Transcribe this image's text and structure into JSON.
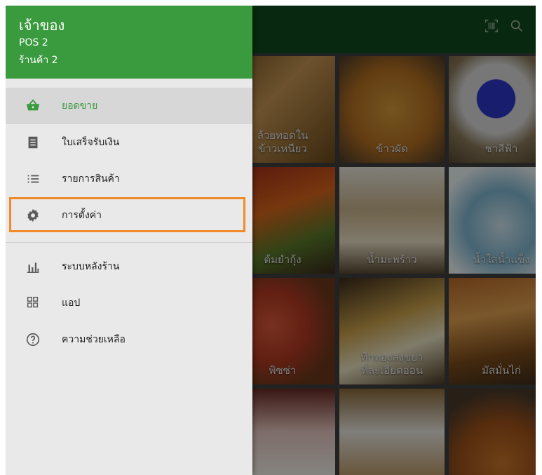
{
  "drawer": {
    "owner": "เจ้าของ",
    "pos": "POS 2",
    "store": "ร้านค้า 2",
    "items": [
      {
        "label": "ยอดขาย",
        "icon": "basket-icon",
        "active": true
      },
      {
        "label": "ใบเสร็จรับเงิน",
        "icon": "receipt-icon"
      },
      {
        "label": "รายการสินค้า",
        "icon": "list-icon"
      },
      {
        "label": "การตั้งค่า",
        "icon": "gear-icon"
      },
      {
        "label": "ระบบหลังร้าน",
        "icon": "bar-chart-icon"
      },
      {
        "label": "แอป",
        "icon": "apps-icon"
      },
      {
        "label": "ความช่วยเหลือ",
        "icon": "help-icon"
      }
    ]
  },
  "appbar": {
    "icons": [
      "barcode-scan-icon",
      "search-icon"
    ]
  },
  "products": [
    {
      "name": "ล้วยทอดใน\nข้าวเหนียว"
    },
    {
      "name": "ข้าวผัด"
    },
    {
      "name": "ชาสีฟ้า"
    },
    {
      "name": "ต้มยำกุ้ง"
    },
    {
      "name": "น้ำมะพร้าว"
    },
    {
      "name": "น้ำใส่น้ำแข็ง"
    },
    {
      "name": "พิซซ่า"
    },
    {
      "name": "ทีกทองสงขยา\nที่ละเอียดอ่อน"
    },
    {
      "name": "มัสมั่นไก่"
    },
    {
      "name": ""
    },
    {
      "name": ""
    },
    {
      "name": ""
    }
  ],
  "colors": {
    "header": "#3a9a3e",
    "accent": "#3a9a3e",
    "highlight": "#f08a2a"
  }
}
